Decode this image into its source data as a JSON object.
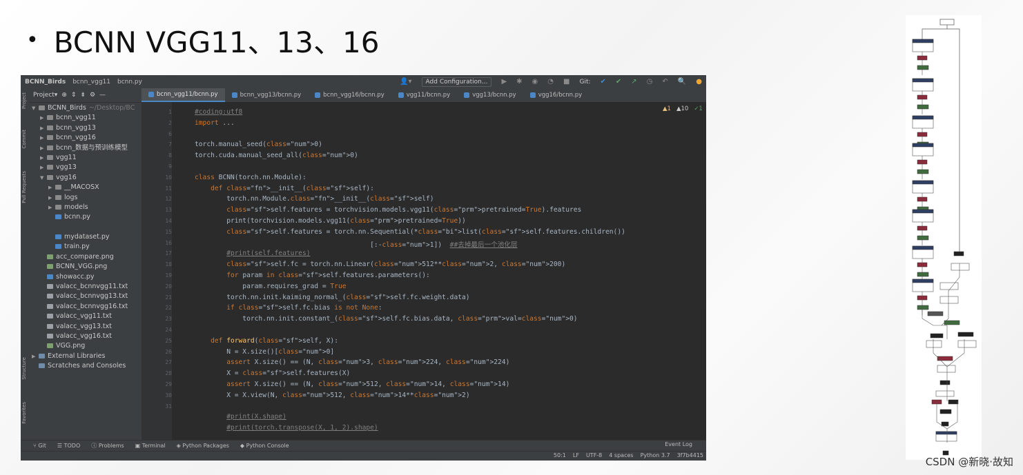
{
  "slide": {
    "title": "BCNN VGG11、13、16"
  },
  "ide": {
    "project_name": "BCNN_Birds",
    "crumb1": "bcnn_vgg11",
    "crumb2": "bcnn.py",
    "add_config": "Add Configuration...",
    "git_label": "Git:",
    "project_tab": "Project▾",
    "tabs": [
      "bcnn_vgg11/bcnn.py",
      "bcnn_vgg13/bcnn.py",
      "bcnn_vgg16/bcnn.py",
      "vgg11/bcnn.py",
      "vgg13/bcnn.py",
      "vgg16/bcnn.py"
    ],
    "side_tabs": {
      "project": "Project",
      "commit": "Commit",
      "pull": "Pull Requests",
      "structure": "Structure",
      "favorites": "Favorites"
    },
    "tree": [
      {
        "indent": 0,
        "arrow": "▼",
        "icon": "folder",
        "label": "BCNN_Birds",
        "extra": "~/Desktop/BC"
      },
      {
        "indent": 1,
        "arrow": "▶",
        "icon": "folder",
        "label": "bcnn_vgg11"
      },
      {
        "indent": 1,
        "arrow": "▶",
        "icon": "folder",
        "label": "bcnn_vgg13"
      },
      {
        "indent": 1,
        "arrow": "▶",
        "icon": "folder",
        "label": "bcnn_vgg16"
      },
      {
        "indent": 1,
        "arrow": "▶",
        "icon": "folder",
        "label": "bcnn_数据与预训练模型"
      },
      {
        "indent": 1,
        "arrow": "▶",
        "icon": "folder",
        "label": "vgg11"
      },
      {
        "indent": 1,
        "arrow": "▶",
        "icon": "folder",
        "label": "vgg13"
      },
      {
        "indent": 1,
        "arrow": "▼",
        "icon": "folder",
        "label": "vgg16"
      },
      {
        "indent": 2,
        "arrow": "▶",
        "icon": "folder",
        "label": "__MACOSX"
      },
      {
        "indent": 2,
        "arrow": "▶",
        "icon": "folder",
        "label": "logs"
      },
      {
        "indent": 2,
        "arrow": "▶",
        "icon": "folder",
        "label": "models"
      },
      {
        "indent": 2,
        "arrow": "",
        "icon": "py",
        "label": "bcnn.py"
      },
      {
        "indent": 2,
        "arrow": "",
        "icon": "none",
        "label": ""
      },
      {
        "indent": 2,
        "arrow": "",
        "icon": "py",
        "label": "mydataset.py"
      },
      {
        "indent": 2,
        "arrow": "",
        "icon": "py",
        "label": "train.py"
      },
      {
        "indent": 1,
        "arrow": "",
        "icon": "png",
        "label": "acc_compare.png"
      },
      {
        "indent": 1,
        "arrow": "",
        "icon": "png",
        "label": "BCNN_VGG.png"
      },
      {
        "indent": 1,
        "arrow": "",
        "icon": "py",
        "label": "showacc.py"
      },
      {
        "indent": 1,
        "arrow": "",
        "icon": "txt",
        "label": "valacc_bcnnvgg11.txt"
      },
      {
        "indent": 1,
        "arrow": "",
        "icon": "txt",
        "label": "valacc_bcnnvgg13.txt"
      },
      {
        "indent": 1,
        "arrow": "",
        "icon": "txt",
        "label": "valacc_bcnnvgg16.txt"
      },
      {
        "indent": 1,
        "arrow": "",
        "icon": "txt",
        "label": "valacc_vgg11.txt"
      },
      {
        "indent": 1,
        "arrow": "",
        "icon": "txt",
        "label": "valacc_vgg13.txt"
      },
      {
        "indent": 1,
        "arrow": "",
        "icon": "txt",
        "label": "valacc_vgg16.txt"
      },
      {
        "indent": 1,
        "arrow": "",
        "icon": "png",
        "label": "VGG.png"
      },
      {
        "indent": 0,
        "arrow": "▶",
        "icon": "lib",
        "label": "External Libraries"
      },
      {
        "indent": 0,
        "arrow": "",
        "icon": "lib",
        "label": "Scratches and Consoles"
      }
    ],
    "inspection": {
      "warnings": "▲1",
      "weak": "▲10",
      "ok": "✓1"
    },
    "line_numbers": [
      "1",
      "2",
      "6",
      "7",
      "8",
      "9",
      "10",
      "11",
      "12",
      "13",
      "14",
      "15",
      "16",
      "17",
      "18",
      "19",
      "20",
      "21",
      "22",
      "23",
      "24",
      "25",
      "26",
      "27",
      "28",
      "29",
      "30",
      "31"
    ],
    "code_lines": [
      "#coding:utf8",
      "import ...",
      "",
      "torch.manual_seed(0)",
      "torch.cuda.manual_seed_all(0)",
      "",
      "class BCNN(torch.nn.Module):",
      "    def __init__(self):",
      "        torch.nn.Module.__init__(self)",
      "        self.features = torchvision.models.vgg11(pretrained=True).features",
      "        print(torchvision.models.vgg11(pretrained=True))",
      "        self.features = torch.nn.Sequential(*list(self.features.children())",
      "                                            [:-1])  ##去掉最后一个池化层",
      "        #print(self.features)",
      "        self.fc = torch.nn.Linear(512**2, 200)",
      "        for param in self.features.parameters():",
      "            param.requires_grad = True",
      "        torch.nn.init.kaiming_normal_(self.fc.weight.data)",
      "        if self.fc.bias is not None:",
      "            torch.nn.init.constant_(self.fc.bias.data, val=0)",
      "",
      "    def forward(self, X):",
      "        N = X.size()[0]",
      "        assert X.size() == (N, 3, 224, 224)",
      "        X = self.features(X)",
      "        assert X.size() == (N, 512, 14, 14)",
      "        X = X.view(N, 512, 14**2)",
      "",
      "        #print(X.shape)",
      "        #print(torch.transpose(X, 1, 2).shape)"
    ],
    "bottom_tools": [
      "Git",
      "TODO",
      "Problems",
      "Terminal",
      "Python Packages",
      "Python Console"
    ],
    "event_log": "Event Log",
    "status": [
      "50:1",
      "LF",
      "UTF-8",
      "4 spaces",
      "Python 3.7",
      "3f7b4415"
    ]
  },
  "watermark": "CSDN @新晓·故知"
}
